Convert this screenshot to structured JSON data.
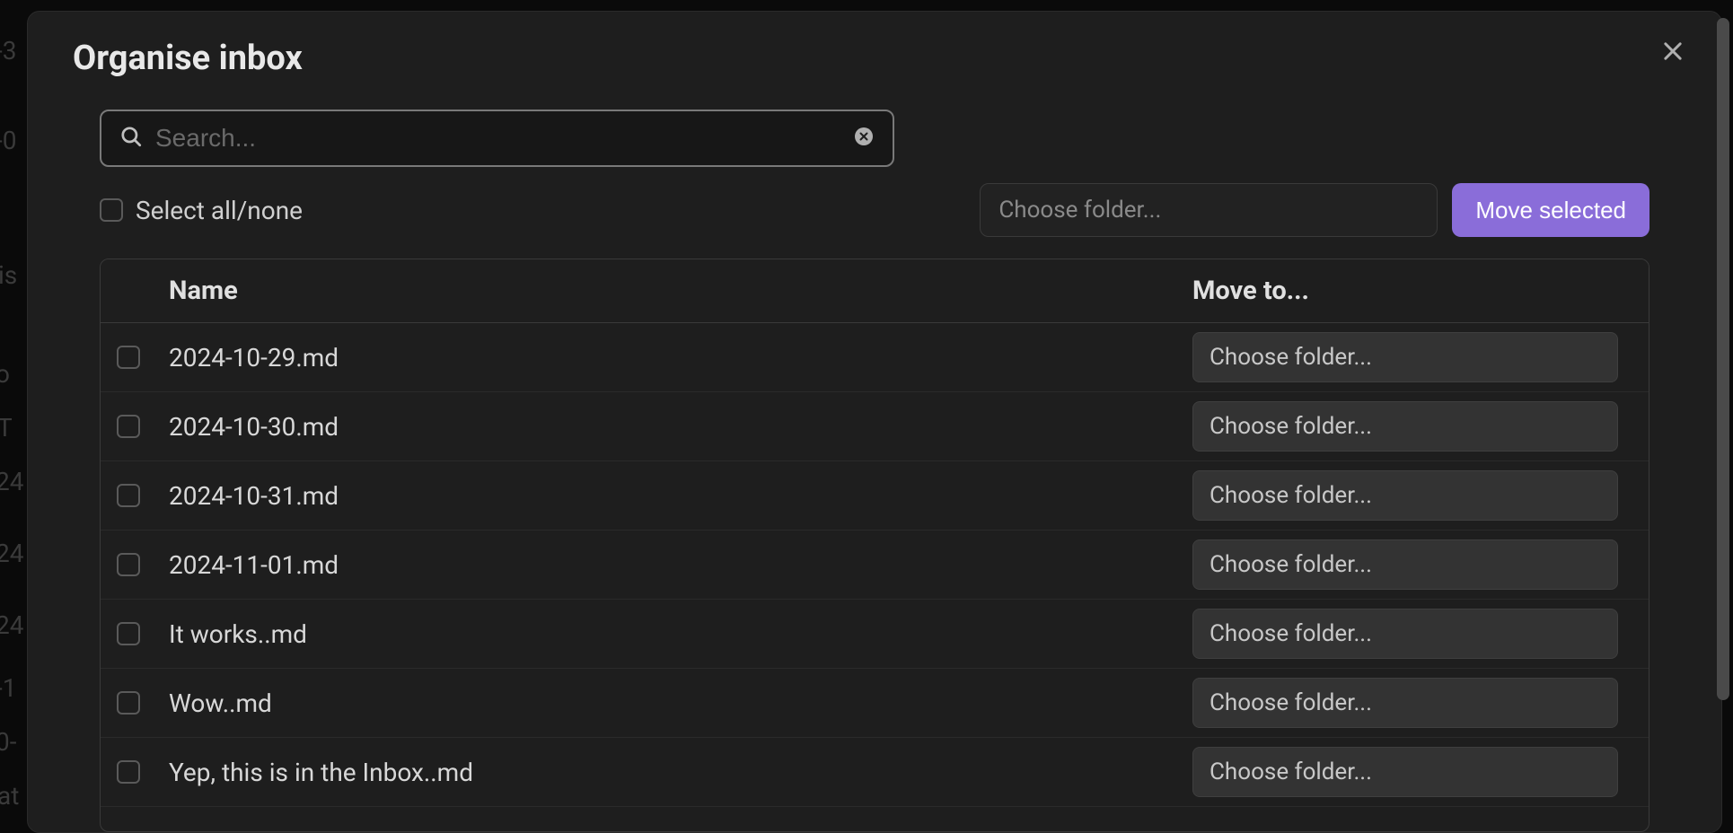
{
  "modal": {
    "title": "Organise inbox"
  },
  "search": {
    "placeholder": "Search..."
  },
  "controls": {
    "select_all_label": "Select all/none",
    "folder_placeholder": "Choose folder...",
    "move_button": "Move selected"
  },
  "table": {
    "headers": {
      "name": "Name",
      "move_to": "Move to..."
    },
    "rows": [
      {
        "name": "2024-10-29.md",
        "folder_label": "Choose folder..."
      },
      {
        "name": "2024-10-30.md",
        "folder_label": "Choose folder..."
      },
      {
        "name": "2024-10-31.md",
        "folder_label": "Choose folder..."
      },
      {
        "name": "2024-11-01.md",
        "folder_label": "Choose folder..."
      },
      {
        "name": "It works..md",
        "folder_label": "Choose folder..."
      },
      {
        "name": "Wow..md",
        "folder_label": "Choose folder..."
      },
      {
        "name": "Yep, this is in the Inbox..md",
        "folder_label": "Choose folder..."
      }
    ]
  },
  "backdrop": {
    "fragments": [
      "-3",
      "-0",
      "is",
      "o",
      "T",
      "24",
      "24",
      "24",
      "-1",
      "0-",
      "at"
    ]
  }
}
